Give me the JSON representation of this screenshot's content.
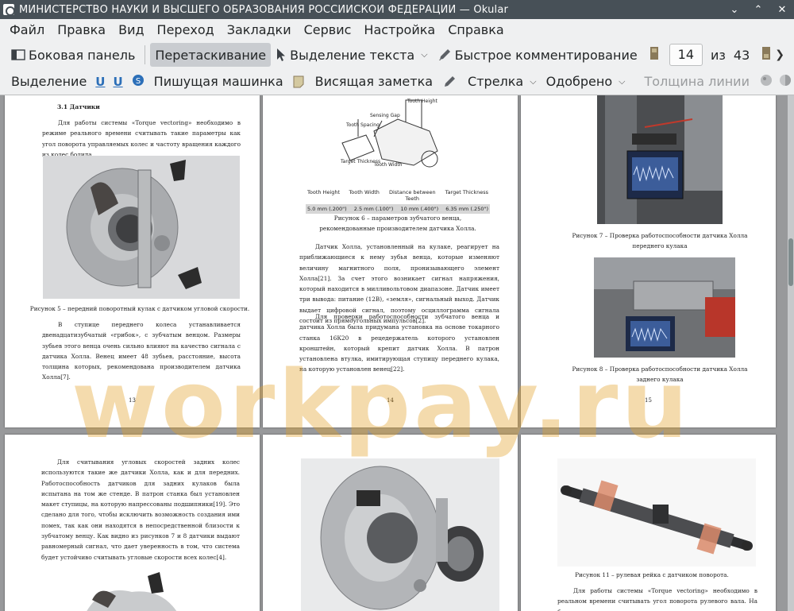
{
  "window": {
    "title": "МИНИСТЕРСТВО НАУКИ И ВЫСШЕГО ОБРАЗОВАНИЯ РОССИЙСКОЙ ФЕДЕРАЦИИ  — Okular",
    "controls": {
      "minimize": "⌄",
      "maximize": "⌃",
      "close": "✕"
    }
  },
  "menu": [
    "Файл",
    "Правка",
    "Вид",
    "Переход",
    "Закладки",
    "Сервис",
    "Настройка",
    "Справка"
  ],
  "toolbar1": {
    "sidebar": "Боковая панель",
    "drag": "Перетаскивание",
    "text_select": "Выделение текста",
    "quick_comment": "Быстрое комментирование",
    "page": "14",
    "of": "из",
    "total": "43"
  },
  "toolbar2": {
    "selection": "Выделение",
    "typewriter": "Пишущая машинка",
    "sticky": "Висящая заметка",
    "arrow": "Стрелка",
    "approved": "Одобрено",
    "line_width": "Толщина линии"
  },
  "watermark": "workpay.ru",
  "pages": {
    "p13": {
      "heading": "3.1 Датчики",
      "para1": "Для работы системы «Torque vectoring» необходимо в режиме реального времени считывать такие параметры как угол поворота управляемых колес и частоту вращения каждого из колес болида.",
      "caption": "Рисунок 5 – передний поворотный кулак с датчиком угловой скорости.",
      "para2": "В ступице переднего колеса устанавливается двенадцатизубчатый «грибок», с зубчатым венцом. Размеры зубьев этого венца очень сильно влияют на качество сигнала с датчика Холла. Венец имеет 48 зубьев, расстояние, высота толщина которых, рекомендована производителем датчика Холла[7].",
      "num": "13"
    },
    "p14": {
      "table_head": [
        "Tooth Height",
        "Tooth Width",
        "Distance between Teeth",
        "Target Thickness"
      ],
      "table_row": [
        "5.0 mm (.200\")",
        "2.5 mm (.100\")",
        "10 mm (.400\")",
        "6.35 mm (.250\")"
      ],
      "diagram_labels": [
        "Tooth Height",
        "Sensing Gap",
        "Tooth Spacing",
        "Target Thickness",
        "Tooth Width"
      ],
      "caption": "Рисунок 6 – параметров зубчатого венца, рекомендованные производителем датчика Холла.",
      "para1": "Датчик Холла, установленный на кулаке, реагирует на приближающиеся к нему зубья венца, которые изменяют величину магнитного поля, пронизывающего элемент Холла[21]. За счет этого возникает сигнал напряжения, который находится в милливольтовом диапазоне. Датчик имеет три вывода: питание (12В), «земля», сигнальный выход. Датчик выдает цифровой сигнал, поэтому осциллограмма сигнала состоит из прямоугольных импульсов[2].",
      "para2": "Для проверки работоспособности зубчатого венца и датчика Холла была придумана установка на основе токарного станка 16К20 в рецедержатель которого установлен кронштейн, который крепит датчик Холла. В патрон установлена втулка, имитирующая ступицу переднего кулака, на которую установлен венец[22].",
      "num": "14"
    },
    "p15": {
      "caption1": "Рисунок 7 – Проверка работоспособности датчика Холла переднего кулака",
      "caption2": "Рисунок 8 – Проверка работоспособности датчика Холла заднего кулака",
      "num": "15"
    },
    "p16": {
      "para": "Для считывания угловых скоростей задних колес используются такие же датчики Холла, как и для передних. Работоспособность датчиков для задних кулаков была испытана на том же стенде. В патрон станка был установлен макет ступицы, на которую напрессованы подшипники[19]. Это сделано для того, чтобы исключить возможность создания ими помех, так как они находятся в непосредственной близости к зубчатому венцу. Как видно из рисунков 7 и 8 датчики выдают равномерный сигнал, что дает уверенность в том, что система будет устойчиво считывать угловые скорости всех колес[4]."
    },
    "p18": {
      "caption": "Рисунок 11 – рулевая рейка с датчиком поворота.",
      "para": "Для работы системы «Torque vectoring» необходимо в реальном времени считывать угол поворота рулевого вала. На болиде используется"
    }
  }
}
